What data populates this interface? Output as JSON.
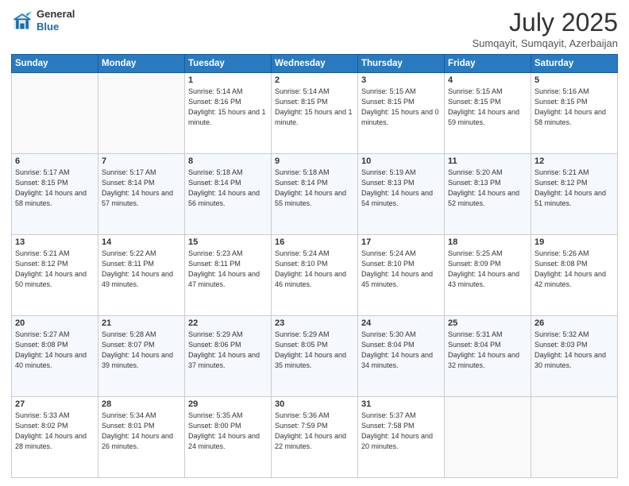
{
  "header": {
    "logo_general": "General",
    "logo_blue": "Blue",
    "month_title": "July 2025",
    "subtitle": "Sumqayit, Sumqayit, Azerbaijan"
  },
  "days_of_week": [
    "Sunday",
    "Monday",
    "Tuesday",
    "Wednesday",
    "Thursday",
    "Friday",
    "Saturday"
  ],
  "weeks": [
    [
      {
        "day": "",
        "info": ""
      },
      {
        "day": "",
        "info": ""
      },
      {
        "day": "1",
        "info": "Sunrise: 5:14 AM\nSunset: 8:16 PM\nDaylight: 15 hours\nand 1 minute."
      },
      {
        "day": "2",
        "info": "Sunrise: 5:14 AM\nSunset: 8:15 PM\nDaylight: 15 hours\nand 1 minute."
      },
      {
        "day": "3",
        "info": "Sunrise: 5:15 AM\nSunset: 8:15 PM\nDaylight: 15 hours\nand 0 minutes."
      },
      {
        "day": "4",
        "info": "Sunrise: 5:15 AM\nSunset: 8:15 PM\nDaylight: 14 hours\nand 59 minutes."
      },
      {
        "day": "5",
        "info": "Sunrise: 5:16 AM\nSunset: 8:15 PM\nDaylight: 14 hours\nand 58 minutes."
      }
    ],
    [
      {
        "day": "6",
        "info": "Sunrise: 5:17 AM\nSunset: 8:15 PM\nDaylight: 14 hours\nand 58 minutes."
      },
      {
        "day": "7",
        "info": "Sunrise: 5:17 AM\nSunset: 8:14 PM\nDaylight: 14 hours\nand 57 minutes."
      },
      {
        "day": "8",
        "info": "Sunrise: 5:18 AM\nSunset: 8:14 PM\nDaylight: 14 hours\nand 56 minutes."
      },
      {
        "day": "9",
        "info": "Sunrise: 5:18 AM\nSunset: 8:14 PM\nDaylight: 14 hours\nand 55 minutes."
      },
      {
        "day": "10",
        "info": "Sunrise: 5:19 AM\nSunset: 8:13 PM\nDaylight: 14 hours\nand 54 minutes."
      },
      {
        "day": "11",
        "info": "Sunrise: 5:20 AM\nSunset: 8:13 PM\nDaylight: 14 hours\nand 52 minutes."
      },
      {
        "day": "12",
        "info": "Sunrise: 5:21 AM\nSunset: 8:12 PM\nDaylight: 14 hours\nand 51 minutes."
      }
    ],
    [
      {
        "day": "13",
        "info": "Sunrise: 5:21 AM\nSunset: 8:12 PM\nDaylight: 14 hours\nand 50 minutes."
      },
      {
        "day": "14",
        "info": "Sunrise: 5:22 AM\nSunset: 8:11 PM\nDaylight: 14 hours\nand 49 minutes."
      },
      {
        "day": "15",
        "info": "Sunrise: 5:23 AM\nSunset: 8:11 PM\nDaylight: 14 hours\nand 47 minutes."
      },
      {
        "day": "16",
        "info": "Sunrise: 5:24 AM\nSunset: 8:10 PM\nDaylight: 14 hours\nand 46 minutes."
      },
      {
        "day": "17",
        "info": "Sunrise: 5:24 AM\nSunset: 8:10 PM\nDaylight: 14 hours\nand 45 minutes."
      },
      {
        "day": "18",
        "info": "Sunrise: 5:25 AM\nSunset: 8:09 PM\nDaylight: 14 hours\nand 43 minutes."
      },
      {
        "day": "19",
        "info": "Sunrise: 5:26 AM\nSunset: 8:08 PM\nDaylight: 14 hours\nand 42 minutes."
      }
    ],
    [
      {
        "day": "20",
        "info": "Sunrise: 5:27 AM\nSunset: 8:08 PM\nDaylight: 14 hours\nand 40 minutes."
      },
      {
        "day": "21",
        "info": "Sunrise: 5:28 AM\nSunset: 8:07 PM\nDaylight: 14 hours\nand 39 minutes."
      },
      {
        "day": "22",
        "info": "Sunrise: 5:29 AM\nSunset: 8:06 PM\nDaylight: 14 hours\nand 37 minutes."
      },
      {
        "day": "23",
        "info": "Sunrise: 5:29 AM\nSunset: 8:05 PM\nDaylight: 14 hours\nand 35 minutes."
      },
      {
        "day": "24",
        "info": "Sunrise: 5:30 AM\nSunset: 8:04 PM\nDaylight: 14 hours\nand 34 minutes."
      },
      {
        "day": "25",
        "info": "Sunrise: 5:31 AM\nSunset: 8:04 PM\nDaylight: 14 hours\nand 32 minutes."
      },
      {
        "day": "26",
        "info": "Sunrise: 5:32 AM\nSunset: 8:03 PM\nDaylight: 14 hours\nand 30 minutes."
      }
    ],
    [
      {
        "day": "27",
        "info": "Sunrise: 5:33 AM\nSunset: 8:02 PM\nDaylight: 14 hours\nand 28 minutes."
      },
      {
        "day": "28",
        "info": "Sunrise: 5:34 AM\nSunset: 8:01 PM\nDaylight: 14 hours\nand 26 minutes."
      },
      {
        "day": "29",
        "info": "Sunrise: 5:35 AM\nSunset: 8:00 PM\nDaylight: 14 hours\nand 24 minutes."
      },
      {
        "day": "30",
        "info": "Sunrise: 5:36 AM\nSunset: 7:59 PM\nDaylight: 14 hours\nand 22 minutes."
      },
      {
        "day": "31",
        "info": "Sunrise: 5:37 AM\nSunset: 7:58 PM\nDaylight: 14 hours\nand 20 minutes."
      },
      {
        "day": "",
        "info": ""
      },
      {
        "day": "",
        "info": ""
      }
    ]
  ]
}
